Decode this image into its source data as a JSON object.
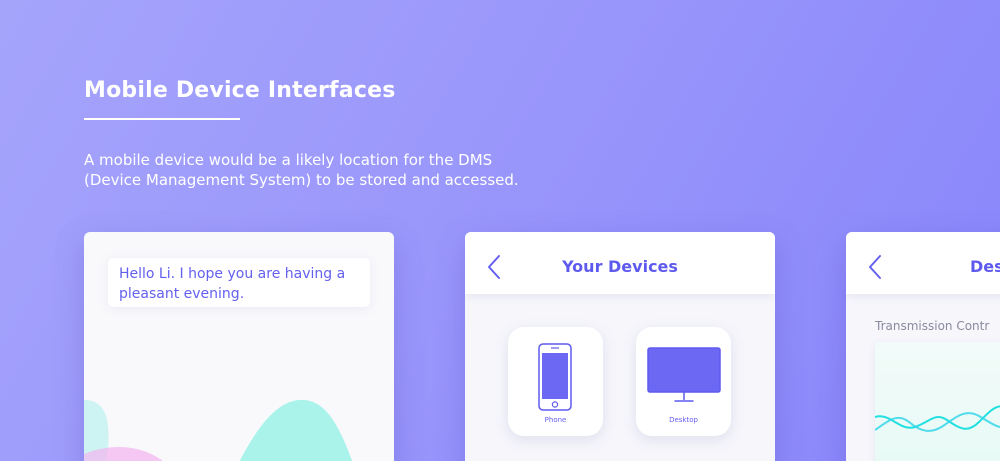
{
  "header": {
    "title": "Mobile Device Interfaces",
    "description_lines": [
      "A mobile device would be a likely location for the DMS",
      "(Device Management System) to be stored and accessed."
    ]
  },
  "screens": [
    {
      "greeting_lines": [
        "Hello Li. I hope you are having a",
        "pleasant evening."
      ]
    },
    {
      "title": "Your Devices",
      "devices": [
        {
          "label": "Phone",
          "icon": "phone-icon"
        },
        {
          "label": "Desktop",
          "icon": "desktop-icon"
        }
      ]
    },
    {
      "title": "Des",
      "section_label": "Transmission Contr"
    }
  ],
  "colors": {
    "background_start": "#a5a4fb",
    "background_end": "#8885fb",
    "accent": "#5f5aee",
    "wave_teal": "#8ff0e6",
    "wave_pink": "#f4b4f0",
    "signal_cyan": "#22e0e0"
  }
}
